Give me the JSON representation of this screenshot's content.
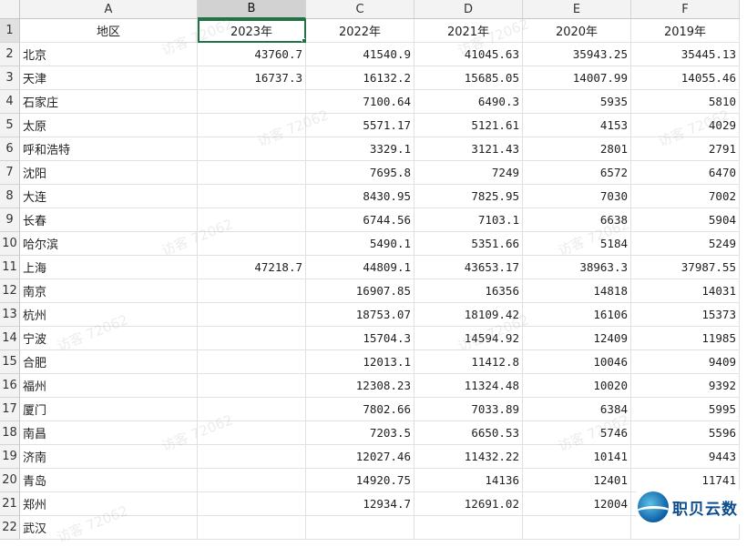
{
  "sheet": {
    "columns": [
      "A",
      "B",
      "C",
      "D",
      "E",
      "F"
    ],
    "active_column": "B",
    "active_cell": "B1",
    "header_row": [
      "地区",
      "2023年",
      "2022年",
      "2021年",
      "2020年",
      "2019年"
    ],
    "rows": [
      {
        "num": "2",
        "cells": [
          "北京",
          "43760.7",
          "41540.9",
          "41045.63",
          "35943.25",
          "35445.13"
        ]
      },
      {
        "num": "3",
        "cells": [
          "天津",
          "16737.3",
          "16132.2",
          "15685.05",
          "14007.99",
          "14055.46"
        ]
      },
      {
        "num": "4",
        "cells": [
          "石家庄",
          "",
          "7100.64",
          "6490.3",
          "5935",
          "5810"
        ]
      },
      {
        "num": "5",
        "cells": [
          "太原",
          "",
          "5571.17",
          "5121.61",
          "4153",
          "4029"
        ]
      },
      {
        "num": "6",
        "cells": [
          "呼和浩特",
          "",
          "3329.1",
          "3121.43",
          "2801",
          "2791"
        ]
      },
      {
        "num": "7",
        "cells": [
          "沈阳",
          "",
          "7695.8",
          "7249",
          "6572",
          "6470"
        ]
      },
      {
        "num": "8",
        "cells": [
          "大连",
          "",
          "8430.95",
          "7825.95",
          "7030",
          "7002"
        ]
      },
      {
        "num": "9",
        "cells": [
          "长春",
          "",
          "6744.56",
          "7103.1",
          "6638",
          "5904"
        ]
      },
      {
        "num": "10",
        "cells": [
          "哈尔滨",
          "",
          "5490.1",
          "5351.66",
          "5184",
          "5249"
        ]
      },
      {
        "num": "11",
        "cells": [
          "上海",
          "47218.7",
          "44809.1",
          "43653.17",
          "38963.3",
          "37987.55"
        ]
      },
      {
        "num": "12",
        "cells": [
          "南京",
          "",
          "16907.85",
          "16356",
          "14818",
          "14031"
        ]
      },
      {
        "num": "13",
        "cells": [
          "杭州",
          "",
          "18753.07",
          "18109.42",
          "16106",
          "15373"
        ]
      },
      {
        "num": "14",
        "cells": [
          "宁波",
          "",
          "15704.3",
          "14594.92",
          "12409",
          "11985"
        ]
      },
      {
        "num": "15",
        "cells": [
          "合肥",
          "",
          "12013.1",
          "11412.8",
          "10046",
          "9409"
        ]
      },
      {
        "num": "16",
        "cells": [
          "福州",
          "",
          "12308.23",
          "11324.48",
          "10020",
          "9392"
        ]
      },
      {
        "num": "17",
        "cells": [
          "厦门",
          "",
          "7802.66",
          "7033.89",
          "6384",
          "5995"
        ]
      },
      {
        "num": "18",
        "cells": [
          "南昌",
          "",
          "7203.5",
          "6650.53",
          "5746",
          "5596"
        ]
      },
      {
        "num": "19",
        "cells": [
          "济南",
          "",
          "12027.46",
          "11432.22",
          "10141",
          "9443"
        ]
      },
      {
        "num": "20",
        "cells": [
          "青岛",
          "",
          "14920.75",
          "14136",
          "12401",
          "11741"
        ]
      },
      {
        "num": "21",
        "cells": [
          "郑州",
          "",
          "12934.7",
          "12691.02",
          "12004",
          ""
        ]
      },
      {
        "num": "22",
        "cells": [
          "武汉",
          "",
          "",
          "",
          "",
          ""
        ]
      }
    ]
  },
  "watermark": {
    "text": "访客 72062"
  },
  "logo": {
    "text": "职贝云数"
  }
}
